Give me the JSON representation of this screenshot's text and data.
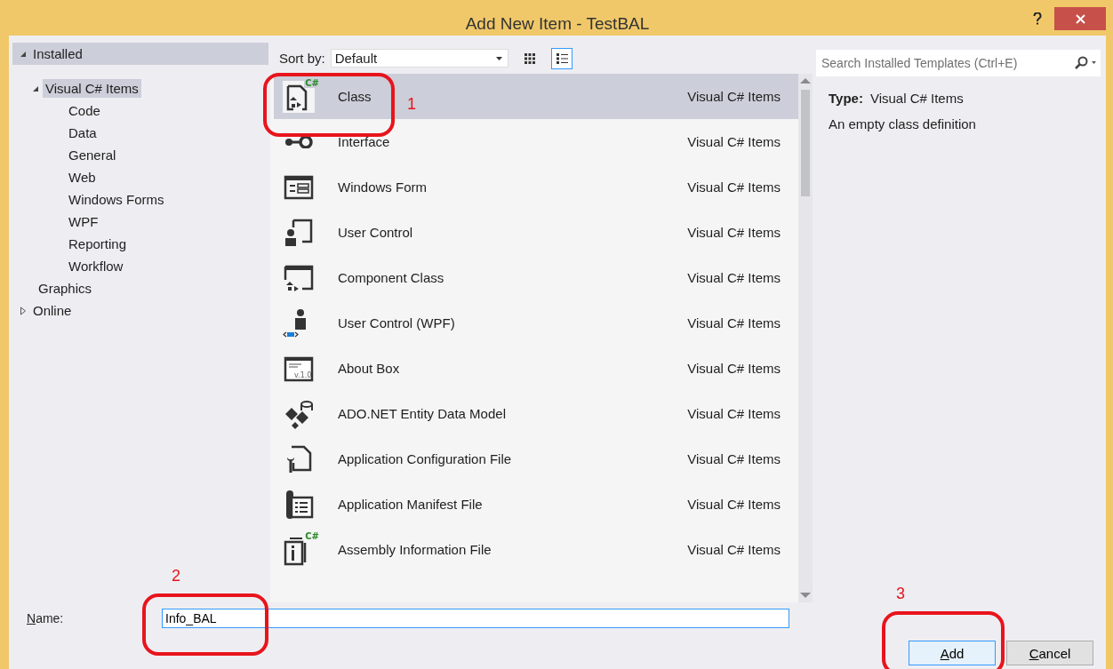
{
  "window": {
    "title": "Add New Item - TestBAL"
  },
  "tree": [
    {
      "label": "Installed",
      "expanded": true,
      "selected": false,
      "children": [
        {
          "label": "Visual C# Items",
          "expanded": true,
          "selected": true,
          "children": [
            {
              "label": "Code",
              "selected": false
            },
            {
              "label": "Data",
              "selected": false
            },
            {
              "label": "General",
              "selected": false
            },
            {
              "label": "Web",
              "selected": false
            },
            {
              "label": "Windows Forms",
              "selected": false
            },
            {
              "label": "WPF",
              "selected": false
            },
            {
              "label": "Reporting",
              "selected": false
            },
            {
              "label": "Workflow",
              "selected": false
            }
          ]
        },
        {
          "label": "Graphics",
          "selected": false
        }
      ]
    },
    {
      "label": "Online",
      "expanded": false,
      "selected": false
    }
  ],
  "toolbar": {
    "sort_label": "Sort by:",
    "sort_value": "Default",
    "views": [
      {
        "kind": "grid",
        "selected": false
      },
      {
        "kind": "list",
        "selected": true
      }
    ]
  },
  "search": {
    "placeholder": "Search Installed Templates (Ctrl+E)"
  },
  "templates": [
    {
      "name": "Class",
      "category": "Visual C# Items",
      "kind": "class",
      "badge": "C#",
      "selected": true
    },
    {
      "name": "Interface",
      "category": "Visual C# Items",
      "kind": "interface",
      "selected": false
    },
    {
      "name": "Windows Form",
      "category": "Visual C# Items",
      "kind": "form",
      "selected": false
    },
    {
      "name": "User Control",
      "category": "Visual C# Items",
      "kind": "usercontrol",
      "selected": false
    },
    {
      "name": "Component Class",
      "category": "Visual C# Items",
      "kind": "component",
      "selected": false
    },
    {
      "name": "User Control (WPF)",
      "category": "Visual C# Items",
      "kind": "wpf",
      "selected": false
    },
    {
      "name": "About Box",
      "category": "Visual C# Items",
      "kind": "about",
      "version": "v.1.0",
      "selected": false
    },
    {
      "name": "ADO.NET Entity Data Model",
      "category": "Visual C# Items",
      "kind": "entity",
      "selected": false
    },
    {
      "name": "Application Configuration File",
      "category": "Visual C# Items",
      "kind": "config",
      "selected": false
    },
    {
      "name": "Application Manifest File",
      "category": "Visual C# Items",
      "kind": "manifest",
      "selected": false
    },
    {
      "name": "Assembly Information File",
      "category": "Visual C# Items",
      "kind": "assembly",
      "badge": "C#",
      "selected": false
    }
  ],
  "details": {
    "type_label": "Type:",
    "type_value": "Visual C# Items",
    "description": "An empty class definition"
  },
  "name_field": {
    "label": "Name:",
    "value": "Info_BAL"
  },
  "buttons": [
    {
      "label": "Add",
      "default": true
    },
    {
      "label": "Cancel",
      "default": false
    }
  ],
  "annotations": [
    {
      "label": "1"
    },
    {
      "label": "2"
    },
    {
      "label": "3"
    }
  ]
}
